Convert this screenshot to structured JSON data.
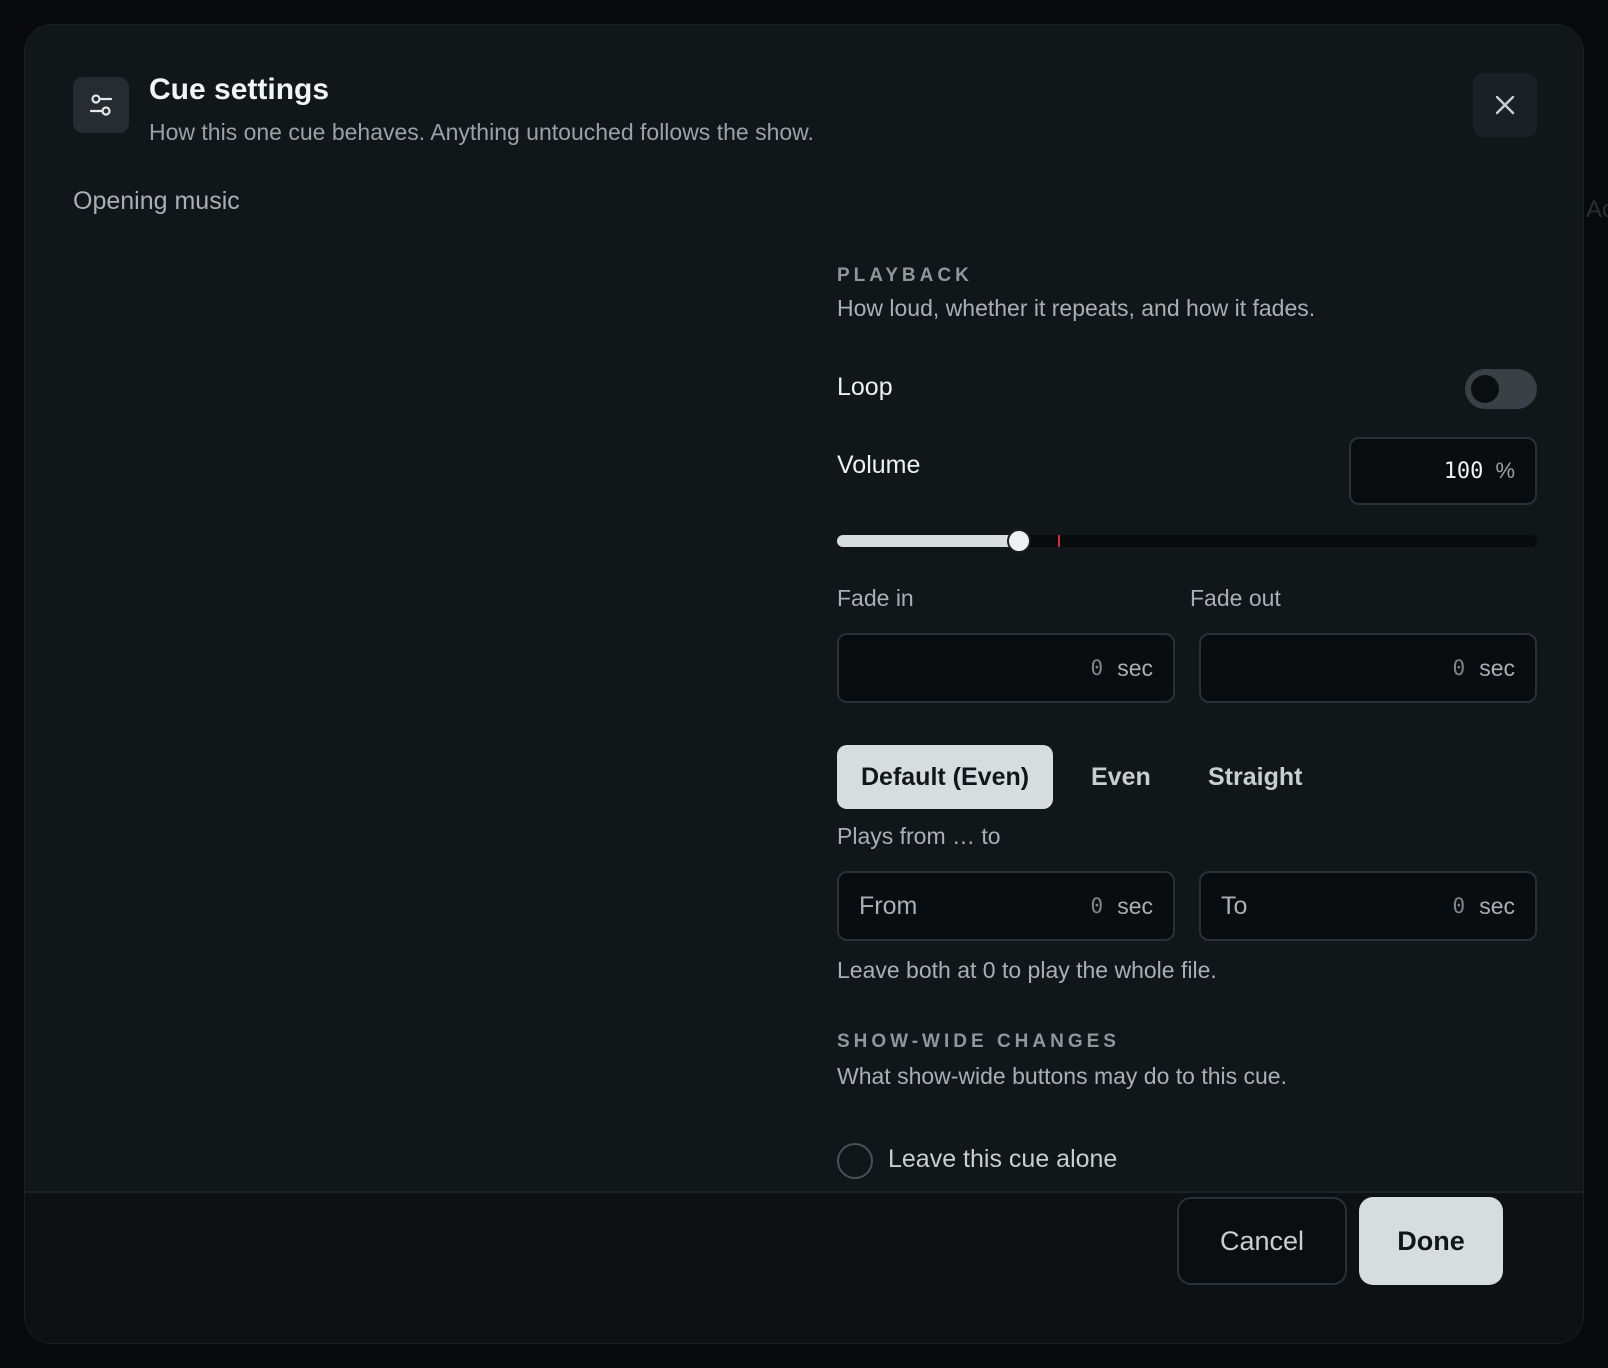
{
  "backdrop": {
    "edge_text": "Ac"
  },
  "dialog": {
    "title": "Cue settings",
    "subtitle": "How this one cue behaves. Anything untouched follows the show.",
    "cue_name": "Opening music"
  },
  "playback": {
    "heading": "PLAYBACK",
    "description": "How loud, whether it repeats, and how it fades.",
    "loop_label": "Loop",
    "loop_enabled": false,
    "volume_label": "Volume",
    "volume_value": "100",
    "volume_unit": "%",
    "volume_slider_fraction": 0.26,
    "volume_marker_fraction": 0.315,
    "fade_in_label": "Fade in",
    "fade_in_value": "0",
    "fade_out_label": "Fade out",
    "fade_out_value": "0",
    "sec_unit": "sec",
    "curve_options": [
      "Default (Even)",
      "Even",
      "Straight"
    ],
    "curve_selected": "Default (Even)",
    "range_label": "Plays from … to",
    "from_label": "From",
    "from_value": "0",
    "to_label": "To",
    "to_value": "0",
    "range_hint": "Leave both at 0 to play the whole file."
  },
  "show_wide": {
    "heading": "SHOW-WIDE CHANGES",
    "description": "What show-wide buttons may do to this cue.",
    "leave_alone_label": "Leave this cue alone",
    "leave_alone_selected": false
  },
  "footer": {
    "cancel_label": "Cancel",
    "done_label": "Done"
  },
  "colors": {
    "accent": "#d7dcdf",
    "marker": "#d2303d",
    "surface": "#111619"
  }
}
